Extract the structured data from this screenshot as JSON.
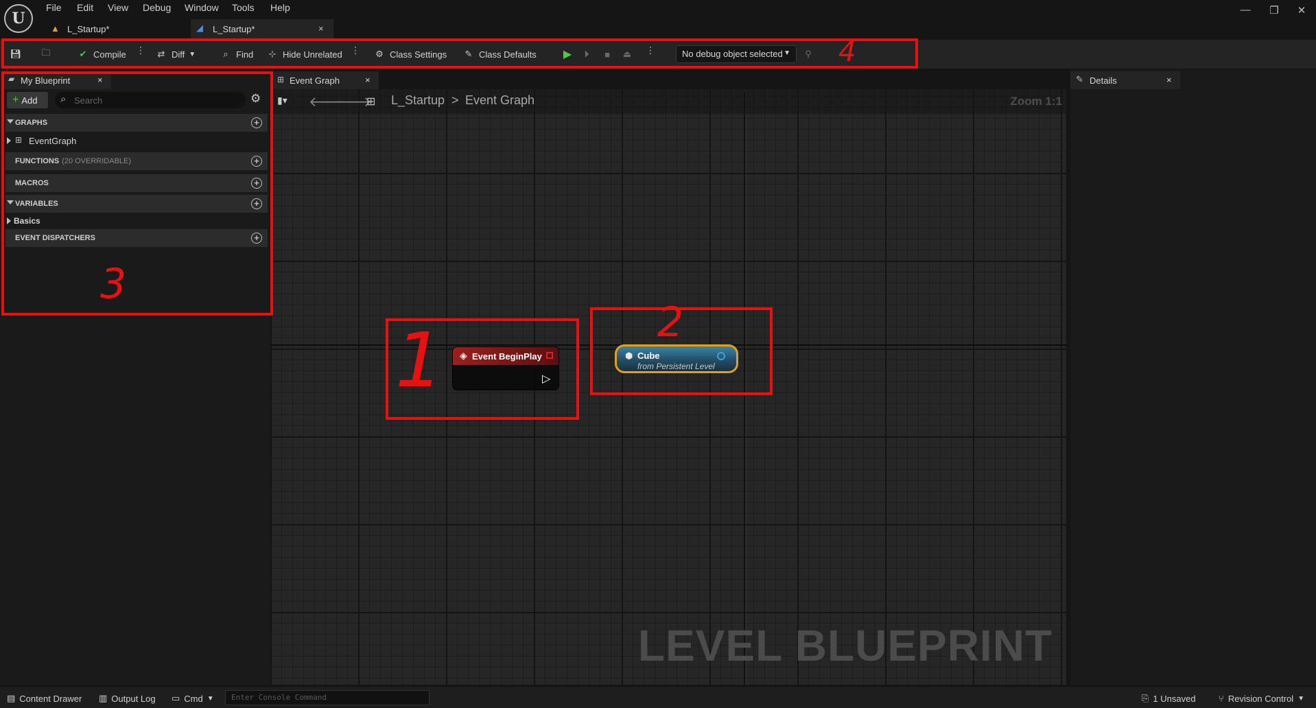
{
  "app": {
    "menu": [
      "File",
      "Edit",
      "View",
      "Debug",
      "Window",
      "Tools",
      "Help"
    ],
    "tabs": [
      {
        "label": "L_Startup*",
        "active": false,
        "icon": "level-icon"
      },
      {
        "label": "L_Startup*",
        "active": true,
        "icon": "blueprint-icon"
      }
    ]
  },
  "toolbar": {
    "compile": "Compile",
    "diff": "Diff",
    "find": "Find",
    "hide_unrelated": "Hide Unrelated",
    "class_settings": "Class Settings",
    "class_defaults": "Class Defaults",
    "debug_object": "No debug object selected"
  },
  "my_blueprint": {
    "tab_label": "My Blueprint",
    "add_label": "Add",
    "search_placeholder": "Search",
    "sections": {
      "graphs": "GRAPHS",
      "event_graph": "EventGraph",
      "functions": "FUNCTIONS",
      "functions_sub": "(20 OVERRIDABLE)",
      "macros": "MACROS",
      "variables": "VARIABLES",
      "basics": "Basics",
      "event_dispatchers": "EVENT DISPATCHERS"
    }
  },
  "graph": {
    "tab_label": "Event Graph",
    "breadcrumb_root": "L_Startup",
    "breadcrumb_sep": ">",
    "breadcrumb_leaf": "Event Graph",
    "zoom": "Zoom 1:1",
    "watermark": "LEVEL BLUEPRINT",
    "nodes": {
      "begin_play_title": "Event BeginPlay",
      "cube_title": "Cube",
      "cube_subtitle": "from Persistent Level"
    }
  },
  "details": {
    "tab_label": "Details"
  },
  "status": {
    "content_drawer": "Content Drawer",
    "output_log": "Output Log",
    "cmd": "Cmd",
    "console_placeholder": "Enter Console Command",
    "unsaved": "1 Unsaved",
    "revision_control": "Revision Control"
  },
  "annotations": [
    "1",
    "2",
    "3",
    "4"
  ],
  "colors": {
    "annotation_red": "#e81010",
    "event_node_header": "#8b1d1d",
    "cube_border": "#e0a020",
    "cube_fill": "#2a6c8c"
  }
}
